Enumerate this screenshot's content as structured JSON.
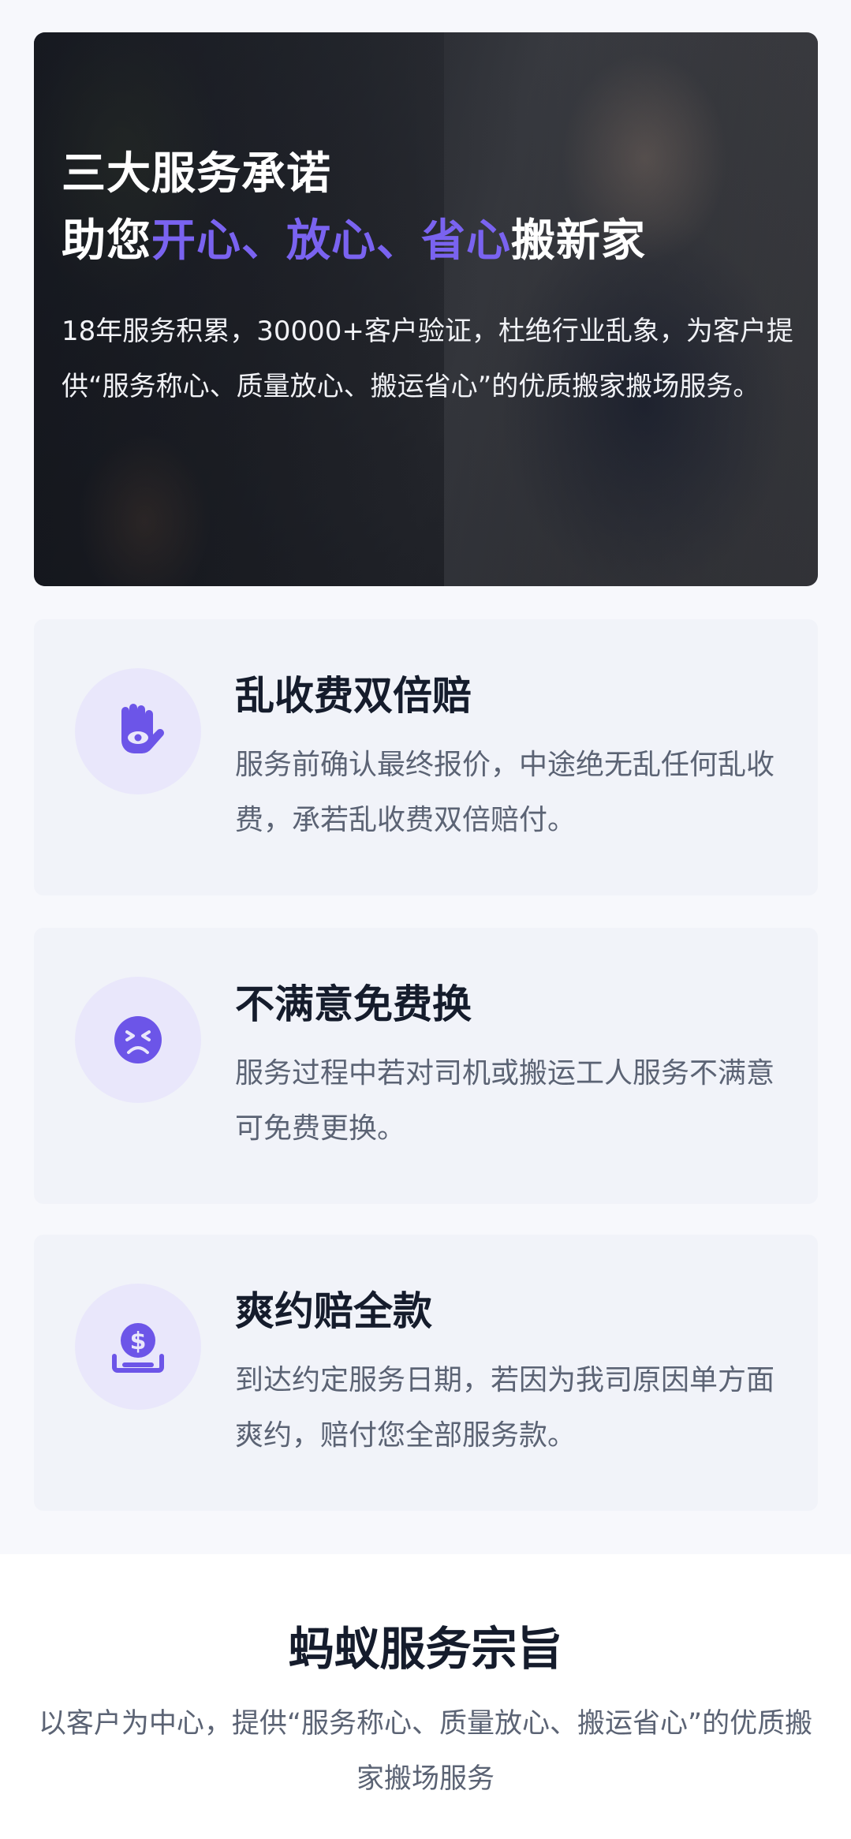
{
  "hero": {
    "title_line1": "三大服务承诺",
    "title_prefix": "助您",
    "title_hl1": "开心、",
    "title_hl2": "放心、",
    "title_hl3": "省心",
    "title_suffix": "搬新家",
    "description": "18年服务积累，30000+客户验证，杜绝行业乱象，为客户提供“服务称心、质量放心、搬运省心”的优质搬家搬场服务。"
  },
  "promises": [
    {
      "icon": "hand-eye-icon",
      "title": "乱收费双倍赔",
      "description": "服务前确认最终报价，中途绝无乱任何乱收费，承若乱收费双倍赔付。"
    },
    {
      "icon": "frown-face-icon",
      "title": "不满意免费换",
      "description": "服务过程中若对司机或搬运工人服务不满意可免费更换。"
    },
    {
      "icon": "dollar-tray-icon",
      "title": "爽约赔全款",
      "description": "到达约定服务日期，若因为我司原因单方面爽约，赔付您全部服务款。"
    }
  ],
  "mission": {
    "title": "蚂蚁服务宗旨",
    "description": "以客户为中心，提供“服务称心、质量放心、搬运省心”的优质搬家搬场服务"
  },
  "colors": {
    "accent": "#7a63f0",
    "icon_bg": "#e9e7fb",
    "card_bg": "#f1f3f9",
    "page_bg": "#f7f8fc"
  }
}
